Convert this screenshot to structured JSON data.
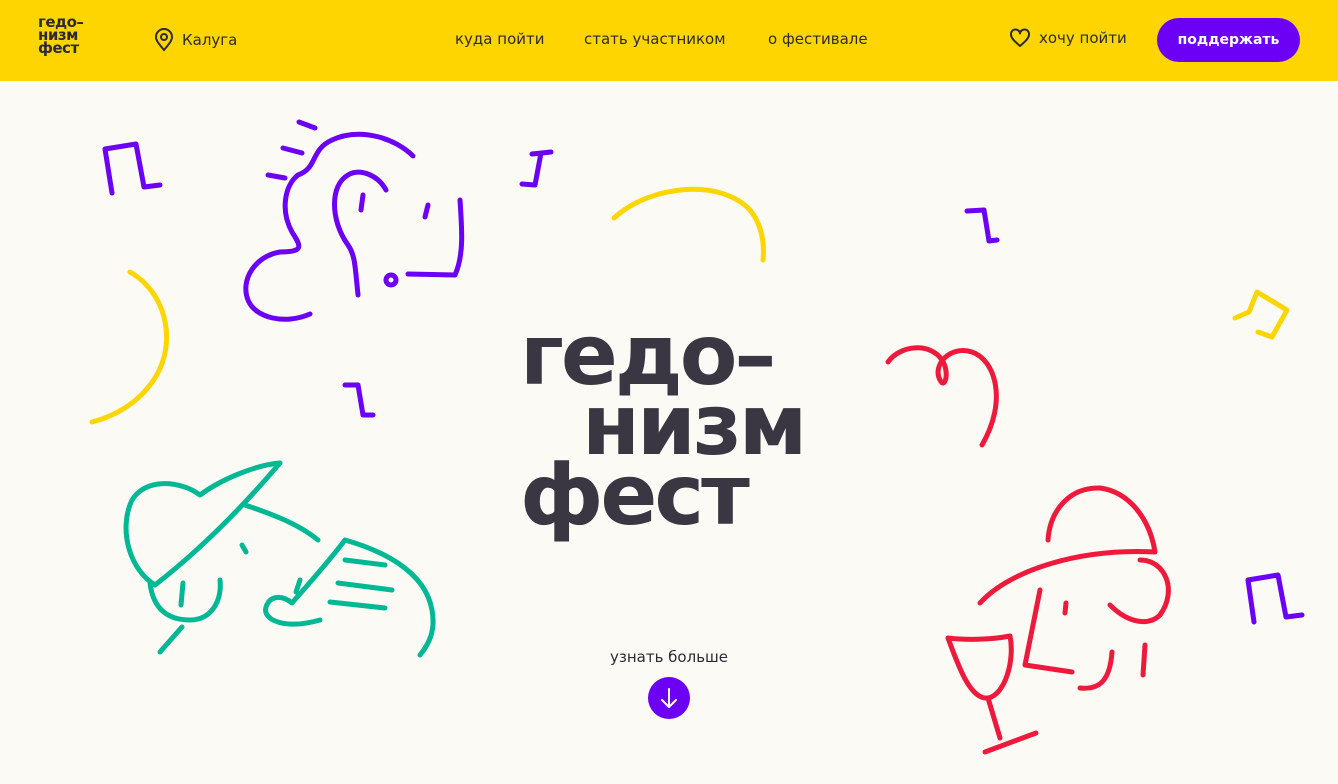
{
  "header": {
    "logo": [
      "гедо–",
      "низм",
      "фест"
    ],
    "city": "Калуга",
    "nav": [
      "куда пойти",
      "стать участником",
      "о фестивале"
    ],
    "wishlist_label": "хочу пойти",
    "support_label": "поддержать"
  },
  "hero": {
    "title": [
      "гедо–",
      "низм",
      "фест"
    ],
    "more_label": "узнать больше"
  },
  "colors": {
    "header_bg": "#ffd500",
    "accent_purple": "#6b00f5",
    "doodle_yellow": "#ffd500",
    "doodle_green": "#00b894",
    "doodle_red": "#ee1a3c",
    "page_bg": "#fbfaf5"
  },
  "icons": [
    "location-pin-icon",
    "heart-icon",
    "arrow-down-icon"
  ]
}
